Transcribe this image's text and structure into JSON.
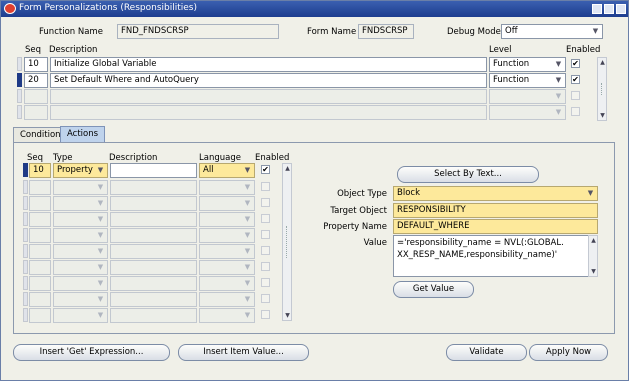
{
  "window": {
    "title": "Form Personalizations (Responsibilities)"
  },
  "header": {
    "function_name_label": "Function Name",
    "function_name_value": "FND_FNDSCRSP",
    "form_name_label": "Form Name",
    "form_name_value": "FNDSCRSP",
    "debug_mode_label": "Debug Mode",
    "debug_mode_value": "Off"
  },
  "rules": {
    "columns": {
      "seq": "Seq",
      "description": "Description",
      "level": "Level",
      "enabled": "Enabled"
    },
    "rows": [
      {
        "seq": "10",
        "description": "Initialize Global Variable",
        "level": "Function",
        "enabled": true,
        "selected": false
      },
      {
        "seq": "20",
        "description": "Set Default Where and AutoQuery",
        "level": "Function",
        "enabled": true,
        "selected": true
      },
      {
        "seq": "",
        "description": "",
        "level": "",
        "enabled": false,
        "selected": false
      },
      {
        "seq": "",
        "description": "",
        "level": "",
        "enabled": false,
        "selected": false
      }
    ]
  },
  "tabs": {
    "condition": "Condition",
    "actions": "Actions"
  },
  "actions": {
    "columns": {
      "seq": "Seq",
      "type": "Type",
      "description": "Description",
      "language": "Language",
      "enabled": "Enabled"
    },
    "rows": [
      {
        "seq": "10",
        "type": "Property",
        "description": "",
        "language": "All",
        "enabled": true
      }
    ],
    "empty_rows": 9
  },
  "detail": {
    "select_by_text": "Select By Text...",
    "object_type_label": "Object Type",
    "object_type_value": "Block",
    "target_object_label": "Target Object",
    "target_object_value": "RESPONSIBILITY",
    "property_name_label": "Property Name",
    "property_name_value": "DEFAULT_WHERE",
    "value_label": "Value",
    "value_line1": "='responsibility_name = NVL(:GLOBAL.",
    "value_line2": "XX_RESP_NAME,responsibility_name)'",
    "get_value": "Get Value"
  },
  "footer": {
    "insert_get_expression": "Insert 'Get' Expression...",
    "insert_item_value": "Insert Item Value...",
    "validate": "Validate",
    "apply_now": "Apply Now"
  },
  "icons": [
    "window-icon",
    "minimize-icon",
    "maximize-icon",
    "close-icon",
    "chevron-down-icon",
    "check-icon",
    "scroll-up-icon",
    "scroll-down-icon"
  ]
}
